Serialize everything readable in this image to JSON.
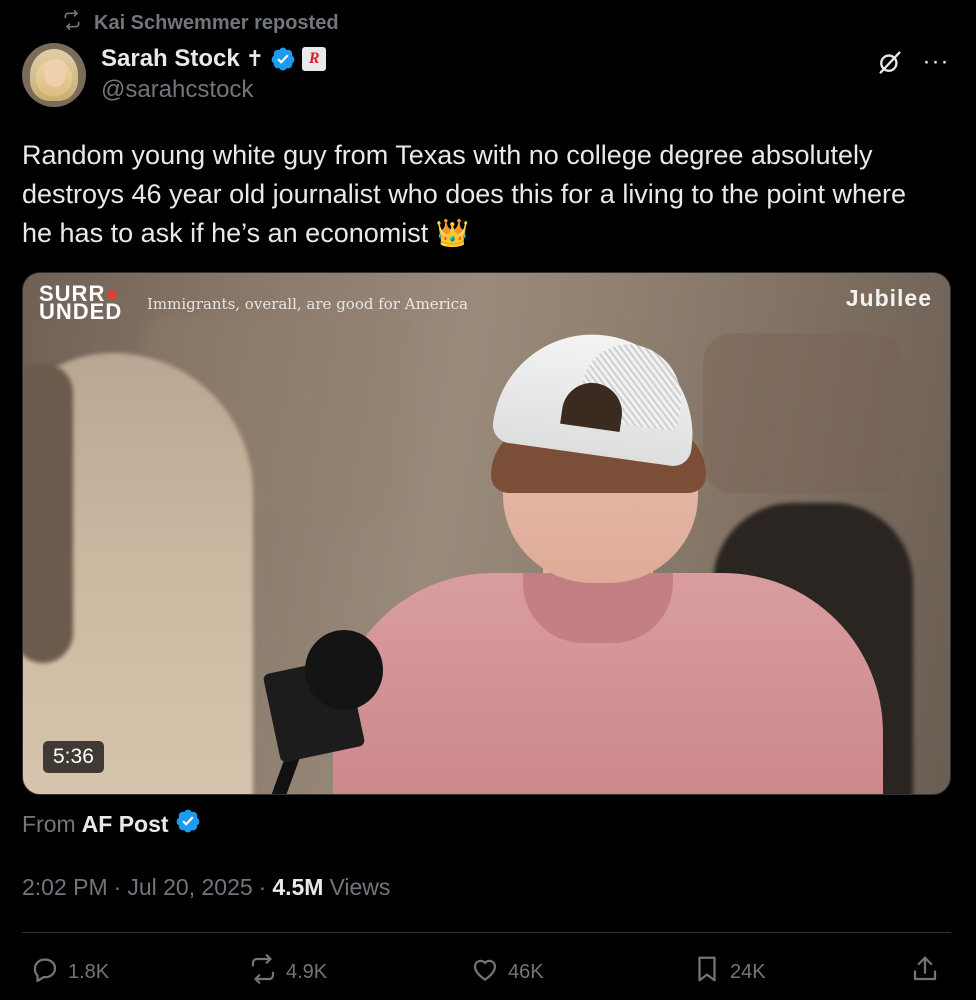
{
  "repost": {
    "text": "Kai Schwemmer reposted"
  },
  "author": {
    "display_name": "Sarah Stock",
    "cross": "✝",
    "brand_badge": "R",
    "handle": "@sarahcstock"
  },
  "tweet": {
    "text": "Random young white guy from Texas with no college degree absolutely destroys 46 year old journalist who does this for a living to the point where he has to ask if he’s an economist 👑"
  },
  "media": {
    "overlay_brand_line1": "SURR",
    "overlay_brand_line1_red": "●",
    "overlay_brand_line2": "UNDED",
    "overlay_caption": "Immigrants, overall, are good for America",
    "overlay_watermark": "Jubilee",
    "duration": "5:36"
  },
  "source": {
    "label": "From",
    "name": "AF Post"
  },
  "meta": {
    "time": "2:02 PM",
    "sep1": "·",
    "date": "Jul 20, 2025",
    "sep2": "·",
    "views_count": "4.5M",
    "views_label": "Views"
  },
  "actions": {
    "replies": "1.8K",
    "reposts": "4.9K",
    "likes": "46K",
    "bookmarks": "24K"
  },
  "colors": {
    "background": "#000000",
    "text_primary": "#e7e9ea",
    "text_secondary": "#71767b",
    "verified_blue": "#1d9bf0",
    "divider": "#2f3336"
  }
}
